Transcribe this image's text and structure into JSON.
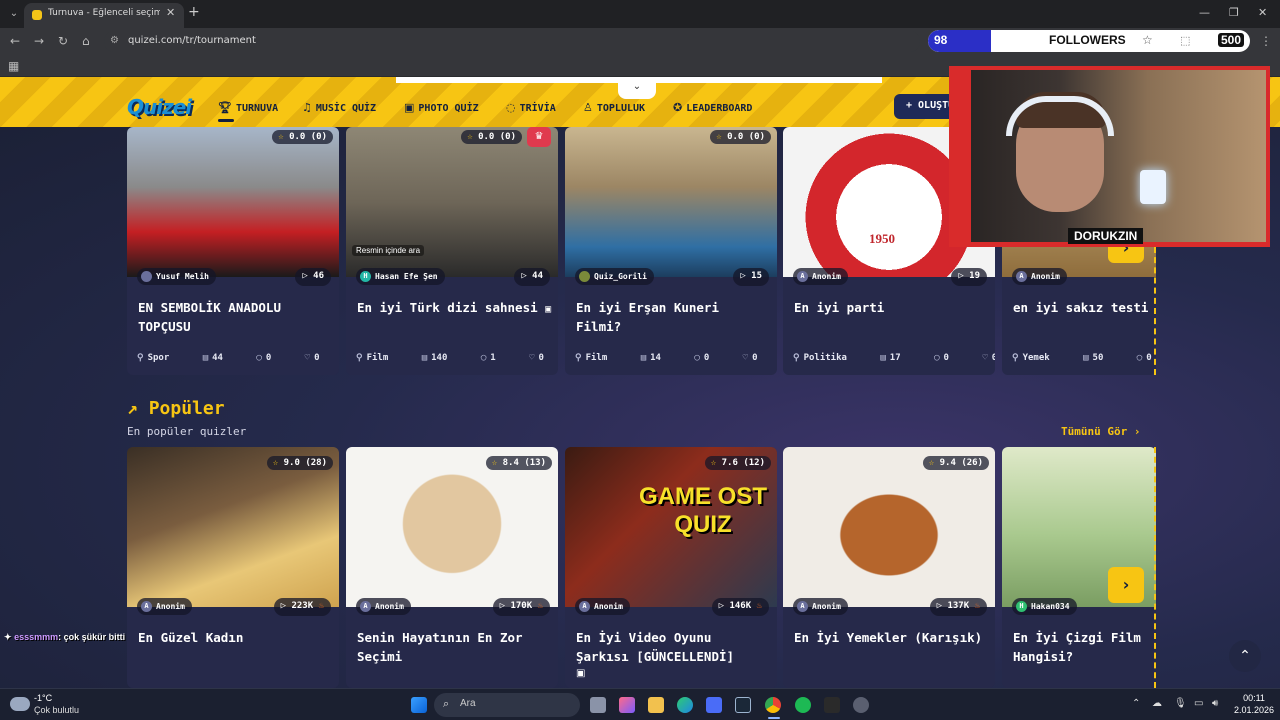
{
  "browser": {
    "tab_title": "Turnuva - Eğlenceli seçimler ya",
    "url": "quizei.com/tr/tournament"
  },
  "stream_overlay": {
    "followers_current": "98",
    "followers_label": "FOLLOWERS",
    "followers_goal": "500",
    "followers_progress_fraction": 0.196,
    "webcam_name": "DORUKZIN",
    "chat_user": "esssmmm",
    "chat_message": ": çok şükür bitti"
  },
  "header": {
    "logo": "Quizei",
    "nav": [
      {
        "label": "TURNUVA",
        "icon": "trophy-icon"
      },
      {
        "label": "MUSİC QUİZ",
        "icon": "music-icon"
      },
      {
        "label": "PHOTO QUİZ",
        "icon": "camera-icon"
      },
      {
        "label": "TRİVİA",
        "icon": "chat-icon"
      },
      {
        "label": "TOPLULUK",
        "icon": "users-icon"
      },
      {
        "label": "LEADERBOARD",
        "icon": "medal-icon"
      }
    ],
    "create_label": "+ OLUŞTUR"
  },
  "top_row": [
    {
      "rating": "0.0 (0)",
      "author": "Yusuf Melih",
      "plays": "46",
      "title": "EN SEMBOLİK ANADOLU TOPÇUSU",
      "category": "Spor",
      "items": "44",
      "comments": "0",
      "likes": "0"
    },
    {
      "rating": "0.0 (0)",
      "author": "Hasan Efe Şen",
      "plays": "44",
      "title": "En iyi Türk dizi sahnesi",
      "category": "Film",
      "items": "140",
      "comments": "1",
      "likes": "0",
      "image_caption": "Resmin içinde ara"
    },
    {
      "rating": "0.0 (0)",
      "author": "Quiz_Gorili",
      "plays": "15",
      "title": "En iyi Erşan Kuneri Filmi?",
      "category": "Film",
      "items": "14",
      "comments": "0",
      "likes": "0"
    },
    {
      "rating": "",
      "author": "Anonim",
      "plays": "19",
      "title": "En iyi parti",
      "category": "Politika",
      "items": "17",
      "comments": "0",
      "likes": "0",
      "image_text": "1950"
    },
    {
      "rating": "",
      "author": "Anonim",
      "plays": "",
      "title": "en iyi sakız testi",
      "category": "Yemek",
      "items": "50",
      "comments": "0",
      "likes": ""
    }
  ],
  "popular_section": {
    "title": "Popüler",
    "subtitle": "En popüler quizler",
    "see_all": "Tümünü Gör ›"
  },
  "popular_row": [
    {
      "rating": "9.0 (28)",
      "author": "Anonim",
      "plays": "223K",
      "title": "En Güzel Kadın"
    },
    {
      "rating": "8.4 (13)",
      "author": "Anonim",
      "plays": "170K",
      "title": "Senin Hayatının En Zor Seçimi"
    },
    {
      "rating": "7.6 (12)",
      "author": "Anonim",
      "plays": "146K",
      "title": "En İyi Video Oyunu Şarkısı [GÜNCELLENDİ]",
      "image_text": "GAME OST QUIZ"
    },
    {
      "rating": "9.4 (26)",
      "author": "Anonim",
      "plays": "137K",
      "title": "En İyi Yemekler (Karışık)"
    },
    {
      "rating": "",
      "author": "Hakan034",
      "plays": "",
      "title": "En İyi Çizgi Film Hangisi?"
    }
  ],
  "taskbar": {
    "temperature": "-1°C",
    "weather": "Çok bulutlu",
    "search_placeholder": "Ara",
    "time": "00:11",
    "date": "2.01.2026"
  },
  "colors": {
    "accent": "#f7c513",
    "background": "#1c2137",
    "card": "#26294a",
    "stream_frame": "#d92b2b"
  }
}
